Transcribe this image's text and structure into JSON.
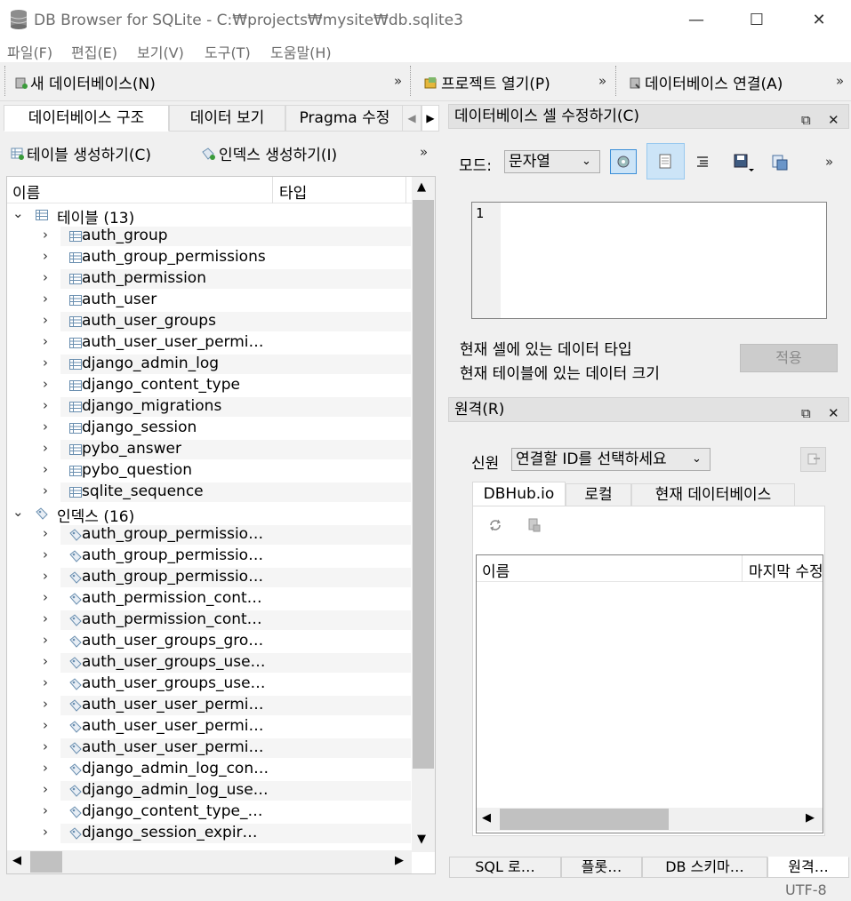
{
  "window": {
    "title": "DB Browser for SQLite - C:₩projects₩mysite₩db.sqlite3",
    "minimize": "—",
    "maximize": "☐",
    "close": "✕"
  },
  "menu": [
    "파일(F)",
    "편집(E)",
    "보기(V)",
    "도구(T)",
    "도움말(H)"
  ],
  "toolbar": {
    "new_db": "새 데이터베이스(N)",
    "open_project": "프로젝트 열기(P)",
    "attach_db": "데이터베이스 연결(A)",
    "more": "»"
  },
  "left_tabs": [
    "데이터베이스 구조",
    "데이터 보기",
    "Pragma 수정"
  ],
  "structure_toolbar": {
    "create_table": "테이블 생성하기(C)",
    "create_index": "인덱스 생성하기(I)",
    "more": "»"
  },
  "tree": {
    "columns": [
      "이름",
      "타입"
    ],
    "tables_group": "테이블 (13)",
    "tables": [
      "auth_group",
      "auth_group_permissions",
      "auth_permission",
      "auth_user",
      "auth_user_groups",
      "auth_user_user_permi…",
      "django_admin_log",
      "django_content_type",
      "django_migrations",
      "django_session",
      "pybo_answer",
      "pybo_question",
      "sqlite_sequence"
    ],
    "indexes_group": "인덱스 (16)",
    "indexes": [
      "auth_group_permissio…",
      "auth_group_permissio…",
      "auth_group_permissio…",
      "auth_permission_cont…",
      "auth_permission_cont…",
      "auth_user_groups_gro…",
      "auth_user_groups_use…",
      "auth_user_groups_use…",
      "auth_user_user_permi…",
      "auth_user_user_permi…",
      "auth_user_user_permi…",
      "django_admin_log_con…",
      "django_admin_log_use…",
      "django_content_type_…",
      "django_session_expir…"
    ]
  },
  "edit_cell": {
    "title": "데이터베이스 셀 수정하기(C)",
    "mode_label": "모드:",
    "mode_value": "문자열",
    "line_number": "1",
    "type_info": "현재 셀에 있는 데이터 타입",
    "size_info": "현재 테이블에 있는 데이터 크기",
    "apply": "적용",
    "more": "»"
  },
  "remote": {
    "title": "원격(R)",
    "identity_label": "신원",
    "identity_value": "연결할 ID를 선택하세요",
    "tabs": [
      "DBHub.io",
      "로컬",
      "현재 데이터베이스"
    ],
    "columns": [
      "이름",
      "마지막 수정"
    ]
  },
  "bottom_tabs": [
    "SQL 로…",
    "플롯…",
    "DB 스키마…",
    "원격…"
  ],
  "status": {
    "encoding": "UTF-8"
  },
  "colors": {
    "selected_button": "#cce4f7",
    "grid_alt": "#f5f5f5",
    "header_bg": "#e2e2e2"
  }
}
